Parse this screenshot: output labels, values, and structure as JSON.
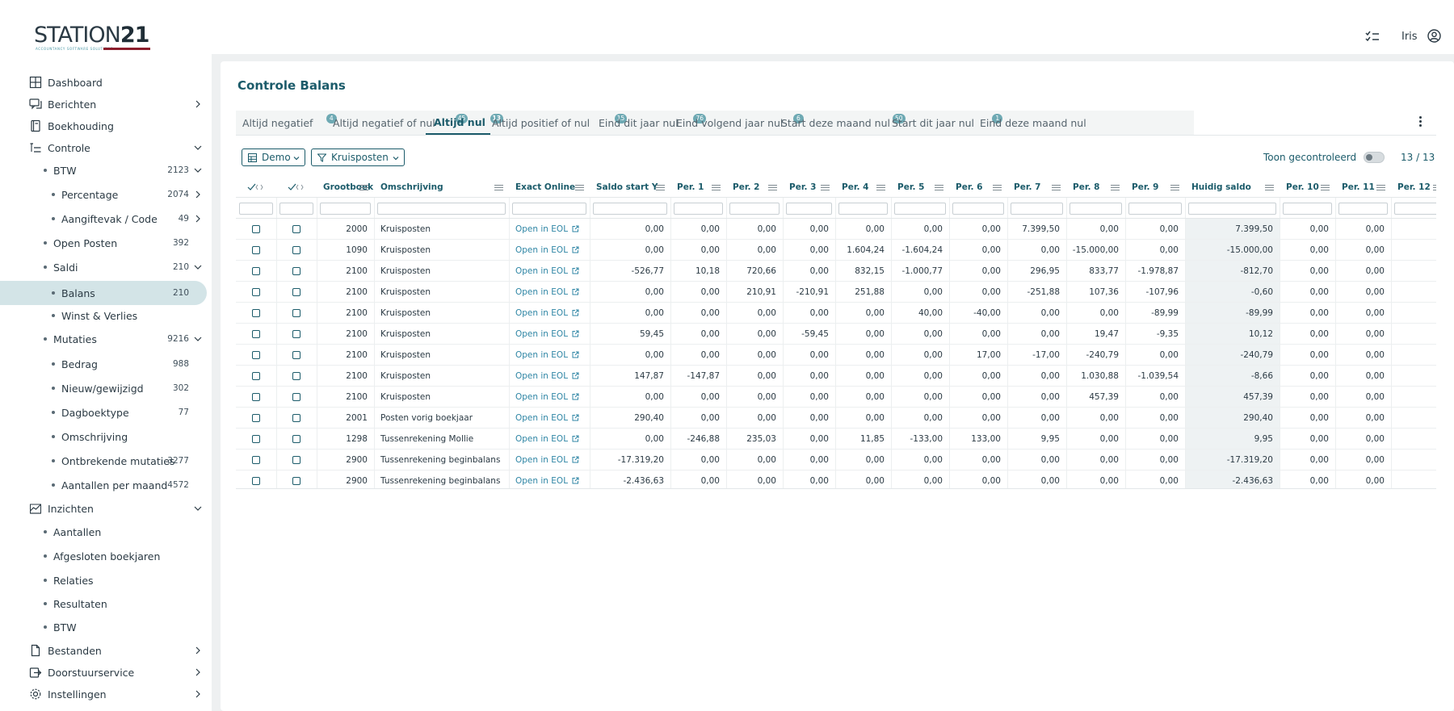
{
  "logo": {
    "word": "STATION",
    "number": "21",
    "tagline": "ACCOUNTANCY SOFTWARE SOLUTIONS"
  },
  "user": {
    "name": "Iris"
  },
  "sidebar": {
    "items": [
      {
        "label": "Dashboard",
        "icon": "grid-icon",
        "level": 0
      },
      {
        "label": "Berichten",
        "icon": "messages-icon",
        "level": 0,
        "chevron": "right"
      },
      {
        "label": "Boekhouding",
        "icon": "book-icon",
        "level": 0
      },
      {
        "label": "Controle",
        "icon": "checklist-icon",
        "level": 0,
        "chevron": "down"
      },
      {
        "label": "BTW",
        "count": "2123",
        "level": 1,
        "chevron": "down"
      },
      {
        "label": "Percentage",
        "count": "2074",
        "level": 2,
        "chevron": "right"
      },
      {
        "label": "Aangiftevak / Code",
        "count": "49",
        "level": 2,
        "chevron": "right"
      },
      {
        "label": "Open Posten",
        "count": "392",
        "level": 1
      },
      {
        "label": "Saldi",
        "count": "210",
        "level": 1,
        "chevron": "down"
      },
      {
        "label": "Balans",
        "count": "210",
        "level": 2,
        "active": true
      },
      {
        "label": "Winst & Verlies",
        "level": 2
      },
      {
        "label": "Mutaties",
        "count": "9216",
        "level": 1,
        "chevron": "down"
      },
      {
        "label": "Bedrag",
        "count": "988",
        "level": 2
      },
      {
        "label": "Nieuw/gewijzigd",
        "count": "302",
        "level": 2
      },
      {
        "label": "Dagboektype",
        "count": "77",
        "level": 2
      },
      {
        "label": "Omschrijving",
        "level": 2
      },
      {
        "label": "Ontbrekende mutaties",
        "count": "3277",
        "level": 2
      },
      {
        "label": "Aantallen per maand",
        "count": "4572",
        "level": 2
      },
      {
        "label": "Inzichten",
        "icon": "chart-icon",
        "level": 0,
        "chevron": "down"
      },
      {
        "label": "Aantallen",
        "level": 1
      },
      {
        "label": "Afgesloten boekjaren",
        "level": 1
      },
      {
        "label": "Relaties",
        "level": 1
      },
      {
        "label": "Resultaten",
        "level": 1
      },
      {
        "label": "BTW",
        "level": 1
      },
      {
        "label": "Bestanden",
        "icon": "file-icon",
        "level": 0,
        "chevron": "right"
      },
      {
        "label": "Doorstuurservice",
        "icon": "forward-icon",
        "level": 0,
        "chevron": "right"
      },
      {
        "label": "Instellingen",
        "icon": "gear-icon",
        "level": 0,
        "chevron": "right"
      }
    ]
  },
  "page": {
    "title": "Controle Balans"
  },
  "tabs": [
    {
      "label": "Altijd negatief",
      "badge": "4"
    },
    {
      "label": "Altijd negatief of nul",
      "badge": "45"
    },
    {
      "label": "Altijd nul",
      "badge": "13",
      "active": true
    },
    {
      "label": "Altijd positief of nul",
      "badge": "15"
    },
    {
      "label": "Eind dit jaar nul",
      "badge": "76"
    },
    {
      "label": "Eind volgend jaar nul",
      "badge": "6"
    },
    {
      "label": "Start deze maand nul",
      "badge": "50"
    },
    {
      "label": "Start dit jaar nul",
      "badge": "1"
    },
    {
      "label": "Eind deze maand nul",
      "badge": ""
    }
  ],
  "toolbar": {
    "demo_label": "Demo",
    "kruisposten_label": "Kruisposten",
    "toon_label": "Toon gecontroleerd",
    "toon_on": false,
    "counter": "13 / 13"
  },
  "grid": {
    "columns": [
      "",
      "",
      "Grootboek",
      "Omschrijving",
      "Exact Online",
      "Saldo start Y",
      "Per. 1",
      "Per. 2",
      "Per. 3",
      "Per. 4",
      "Per. 5",
      "Per. 6",
      "Per. 7",
      "Per. 8",
      "Per. 9",
      "Huidig saldo",
      "Per. 10",
      "Per. 11",
      "Per. 12"
    ],
    "link_text": "Open in EOL",
    "rows": [
      [
        "2000",
        "Kruisposten",
        "0,00",
        "0,00",
        "0,00",
        "0,00",
        "0,00",
        "0,00",
        "0,00",
        "7.399,50",
        "0,00",
        "0,00",
        "7.399,50",
        "0,00",
        "0,00",
        "0,"
      ],
      [
        "1090",
        "Kruisposten",
        "0,00",
        "0,00",
        "0,00",
        "0,00",
        "1.604,24",
        "-1.604,24",
        "0,00",
        "0,00",
        "-15.000,00",
        "0,00",
        "-15.000,00",
        "0,00",
        "0,00",
        "0,"
      ],
      [
        "2100",
        "Kruisposten",
        "-526,77",
        "10,18",
        "720,66",
        "0,00",
        "832,15",
        "-1.000,77",
        "0,00",
        "296,95",
        "833,77",
        "-1.978,87",
        "-812,70",
        "0,00",
        "0,00",
        "0,"
      ],
      [
        "2100",
        "Kruisposten",
        "0,00",
        "0,00",
        "210,91",
        "-210,91",
        "251,88",
        "0,00",
        "0,00",
        "-251,88",
        "107,36",
        "-107,96",
        "-0,60",
        "0,00",
        "0,00",
        "0,"
      ],
      [
        "2100",
        "Kruisposten",
        "0,00",
        "0,00",
        "0,00",
        "0,00",
        "0,00",
        "40,00",
        "-40,00",
        "0,00",
        "0,00",
        "-89,99",
        "-89,99",
        "0,00",
        "0,00",
        "0,"
      ],
      [
        "2100",
        "Kruisposten",
        "59,45",
        "0,00",
        "0,00",
        "-59,45",
        "0,00",
        "0,00",
        "0,00",
        "0,00",
        "19,47",
        "-9,35",
        "10,12",
        "0,00",
        "0,00",
        "0,"
      ],
      [
        "2100",
        "Kruisposten",
        "0,00",
        "0,00",
        "0,00",
        "0,00",
        "0,00",
        "0,00",
        "17,00",
        "-17,00",
        "-240,79",
        "0,00",
        "-240,79",
        "0,00",
        "0,00",
        "0,"
      ],
      [
        "2100",
        "Kruisposten",
        "147,87",
        "-147,87",
        "0,00",
        "0,00",
        "0,00",
        "0,00",
        "0,00",
        "0,00",
        "1.030,88",
        "-1.039,54",
        "-8,66",
        "0,00",
        "0,00",
        "0,"
      ],
      [
        "2100",
        "Kruisposten",
        "0,00",
        "0,00",
        "0,00",
        "0,00",
        "0,00",
        "0,00",
        "0,00",
        "0,00",
        "457,39",
        "0,00",
        "457,39",
        "0,00",
        "0,00",
        "0,"
      ],
      [
        "2001",
        "Posten vorig boekjaar",
        "290,40",
        "0,00",
        "0,00",
        "0,00",
        "0,00",
        "0,00",
        "0,00",
        "0,00",
        "0,00",
        "0,00",
        "290,40",
        "0,00",
        "0,00",
        "0,"
      ],
      [
        "1298",
        "Tussenrekening Mollie",
        "0,00",
        "-246,88",
        "235,03",
        "0,00",
        "11,85",
        "-133,00",
        "133,00",
        "9,95",
        "0,00",
        "0,00",
        "9,95",
        "0,00",
        "0,00",
        "0,"
      ],
      [
        "2900",
        "Tussenrekening beginbalans",
        "-17.319,20",
        "0,00",
        "0,00",
        "0,00",
        "0,00",
        "0,00",
        "0,00",
        "0,00",
        "0,00",
        "0,00",
        "-17.319,20",
        "0,00",
        "0,00",
        "0,"
      ],
      [
        "2900",
        "Tussenrekening beginbalans",
        "-2.436,63",
        "0,00",
        "0,00",
        "0,00",
        "0,00",
        "0,00",
        "0,00",
        "0,00",
        "0,00",
        "0,00",
        "-2.436,63",
        "0,00",
        "0,00",
        "0,"
      ]
    ]
  },
  "colors": {
    "accent": "#1b5b6a",
    "link": "#2f86a5",
    "badge": "#6ea9b3",
    "active_bg": "#d3e4e7",
    "brand_red": "#8b1d2c"
  }
}
